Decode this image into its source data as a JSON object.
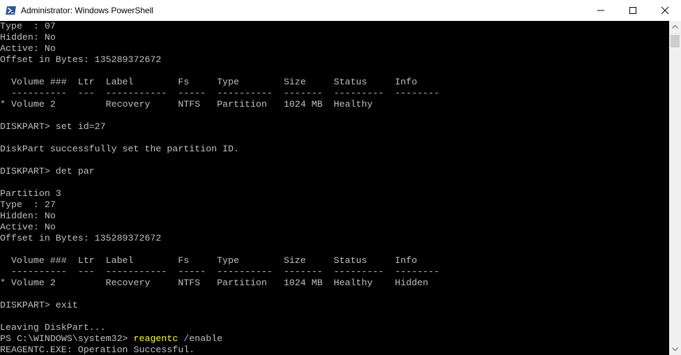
{
  "window": {
    "title": "Administrator: Windows PowerShell",
    "icon": "powershell-icon",
    "controls": {
      "minimize": "minimize-icon",
      "maximize": "maximize-icon",
      "close": "close-icon"
    }
  },
  "colors": {
    "console_background": "#000000",
    "console_text": "#c0c0c0",
    "command_highlight": "#ffff00",
    "titlebar_background": "#ffffff",
    "powershell_icon": "#2b5797"
  },
  "console": {
    "lines": [
      "Type  : 07",
      "Hidden: No",
      "Active: No",
      "Offset in Bytes: 135289372672",
      "",
      "  Volume ###  Ltr  Label        Fs     Type        Size     Status     Info",
      "  ----------  ---  -----------  -----  ----------  -------  ---------  --------",
      "* Volume 2         Recovery     NTFS   Partition   1024 MB  Healthy",
      "",
      "DISKPART> set id=27",
      "",
      "DiskPart successfully set the partition ID.",
      "",
      "DISKPART> det par",
      "",
      "Partition 3",
      "Type  : 27",
      "Hidden: No",
      "Active: No",
      "Offset in Bytes: 135289372672",
      "",
      "  Volume ###  Ltr  Label        Fs     Type        Size     Status     Info",
      "  ----------  ---  -----------  -----  ----------  -------  ---------  --------",
      "* Volume 2         Recovery     NTFS   Partition   1024 MB  Healthy    Hidden",
      "",
      "DISKPART> exit",
      "",
      "Leaving DiskPart..."
    ],
    "ps_command": {
      "prompt": "PS C:\\WINDOWS\\system32> ",
      "command": "reagentc",
      "args": " /enable"
    },
    "final_line": "REAGENTC.EXE: Operation Successful."
  },
  "scrollbar": {
    "up_icon": "arrow-up-icon",
    "down_icon": "arrow-down-icon"
  }
}
